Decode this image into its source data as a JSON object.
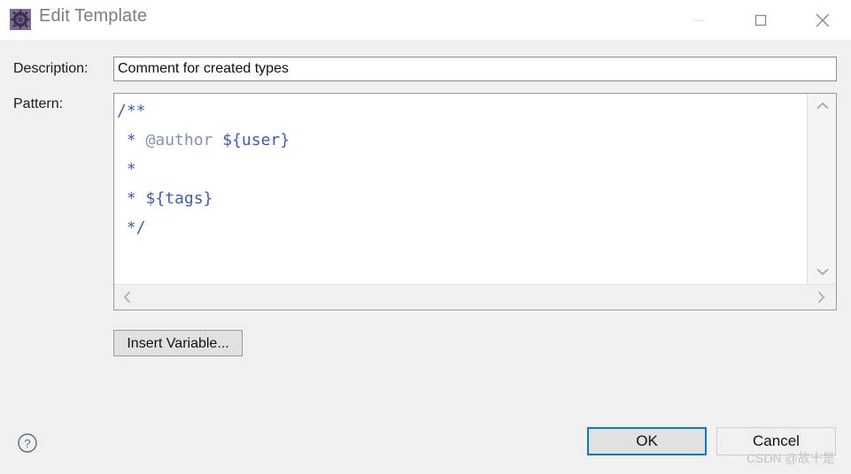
{
  "window": {
    "title": "Edit Template",
    "icon": "template-gear-icon",
    "controls": {
      "minimize_label": "Minimize",
      "maximize_label": "Maximize",
      "close_label": "Close"
    }
  },
  "form": {
    "description_label": "Description:",
    "description_value": "Comment for created types",
    "description_placeholder": "",
    "pattern_label": "Pattern:",
    "pattern_lines": [
      [
        {
          "text": "/**",
          "kind": "plain"
        }
      ],
      [
        {
          "text": " * ",
          "kind": "plain"
        },
        {
          "text": "@author",
          "kind": "tag"
        },
        {
          "text": " ",
          "kind": "plain"
        },
        {
          "text": "${user}",
          "kind": "var"
        }
      ],
      [
        {
          "text": " *",
          "kind": "plain"
        }
      ],
      [
        {
          "text": " * ",
          "kind": "plain"
        },
        {
          "text": "${tags}",
          "kind": "var"
        }
      ],
      [
        {
          "text": " */",
          "kind": "plain"
        }
      ]
    ],
    "pattern_plain_text": "/**\n * @author ${user}\n *\n * ${tags}\n */"
  },
  "actions": {
    "insert_variable_label": "Insert Variable...",
    "ok_label": "OK",
    "cancel_label": "Cancel",
    "help_label": "?"
  },
  "scrollbars": {
    "v_up": "chevron-up",
    "v_down": "chevron-down",
    "h_left": "chevron-left",
    "h_right": "chevron-right"
  },
  "watermark": "CSDN @故十是",
  "colors": {
    "dialog_bg": "#f0f0f0",
    "titlebar_bg": "#ffffff",
    "accent_focus": "#0a7bcc",
    "code_text": "#3e5bbf",
    "code_tag": "#8492b8",
    "icon_purple": "#7c6a96"
  }
}
